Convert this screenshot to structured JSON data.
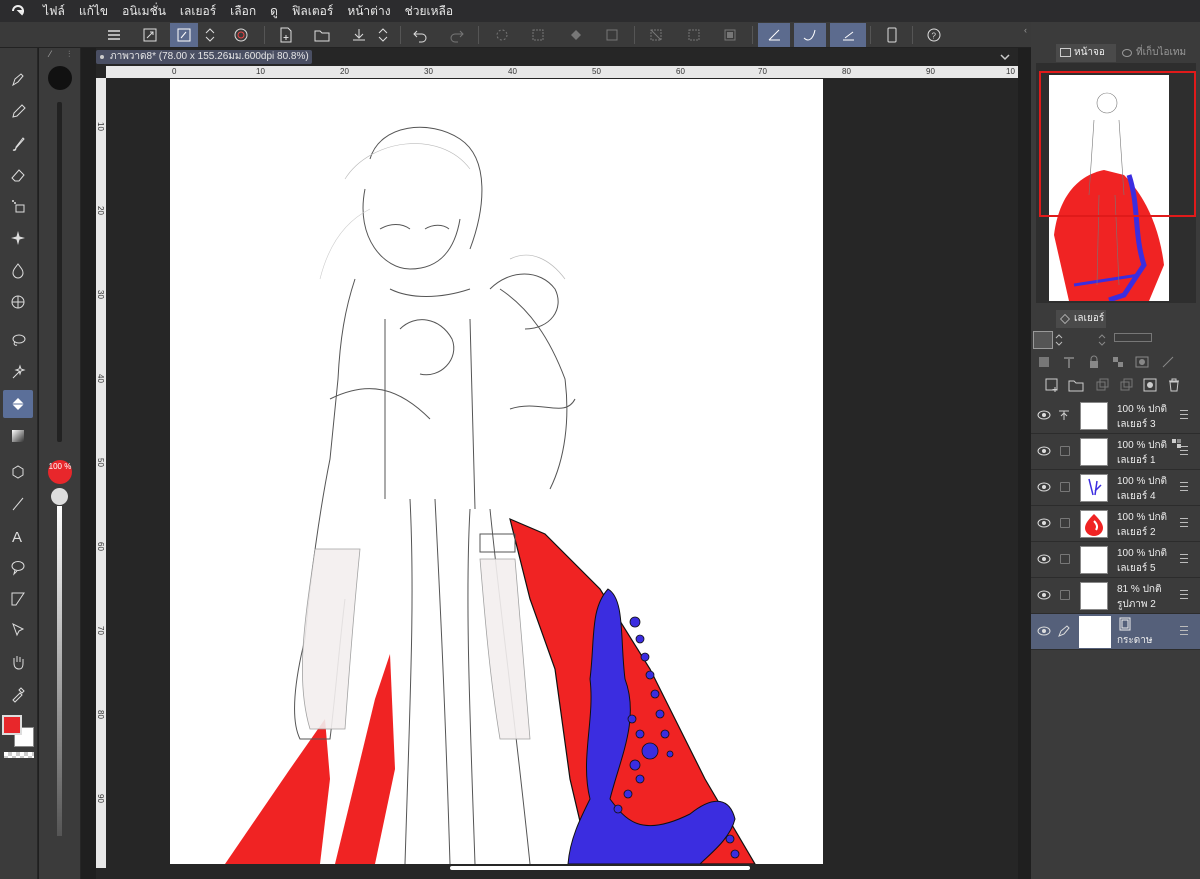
{
  "menubar": {
    "items": [
      "ไฟล์",
      "แก้ไข",
      "อนิเมชั่น",
      "เลเยอร์",
      "เลือก",
      "ดู",
      "ฟิลเตอร์",
      "หน้าต่าง",
      "ช่วยเหลือ"
    ]
  },
  "document": {
    "tab_title": "ภาพวาด8* (78.00 x 155.26มม.600dpi 80.8%)"
  },
  "rulers": {
    "horizontal": [
      "0",
      "10",
      "20",
      "30",
      "40",
      "50",
      "60",
      "70",
      "80",
      "90",
      "10"
    ],
    "vertical": [
      "10",
      "20",
      "30",
      "40",
      "50",
      "60",
      "70",
      "80",
      "90"
    ]
  },
  "brush": {
    "opacity_label": "100 %"
  },
  "colors": {
    "main": "#e8272b",
    "sub": "#ffffff",
    "accent": "#5b6f99",
    "fill_red": "#f02323",
    "fill_blue": "#3b2de0"
  },
  "navigator": {
    "tab_active": "หน้าจอ",
    "tab_other": "ที่เก็บไอเทม"
  },
  "layers_panel": {
    "tab": "เลเยอร์",
    "layers": [
      {
        "opacity": "100 %",
        "blend": "ปกติ",
        "name": "เลเยอร์ 3",
        "icon": "reference-icon"
      },
      {
        "opacity": "100 %",
        "blend": "ปกติ",
        "name": "เลเยอร์ 1",
        "icon": "lock-transparency-icon"
      },
      {
        "opacity": "100 %",
        "blend": "ปกติ",
        "name": "เลเยอร์ 4",
        "icon": "none"
      },
      {
        "opacity": "100 %",
        "blend": "ปกติ",
        "name": "เลเยอร์ 2",
        "icon": "none"
      },
      {
        "opacity": "100 %",
        "blend": "ปกติ",
        "name": "เลเยอร์ 5",
        "icon": "none"
      },
      {
        "opacity": "81 %",
        "blend": "ปกติ",
        "name": "รูปภาพ 2",
        "icon": "none"
      },
      {
        "opacity": "",
        "blend": "",
        "name": "กระดาษ",
        "icon": "paper-icon"
      }
    ]
  }
}
